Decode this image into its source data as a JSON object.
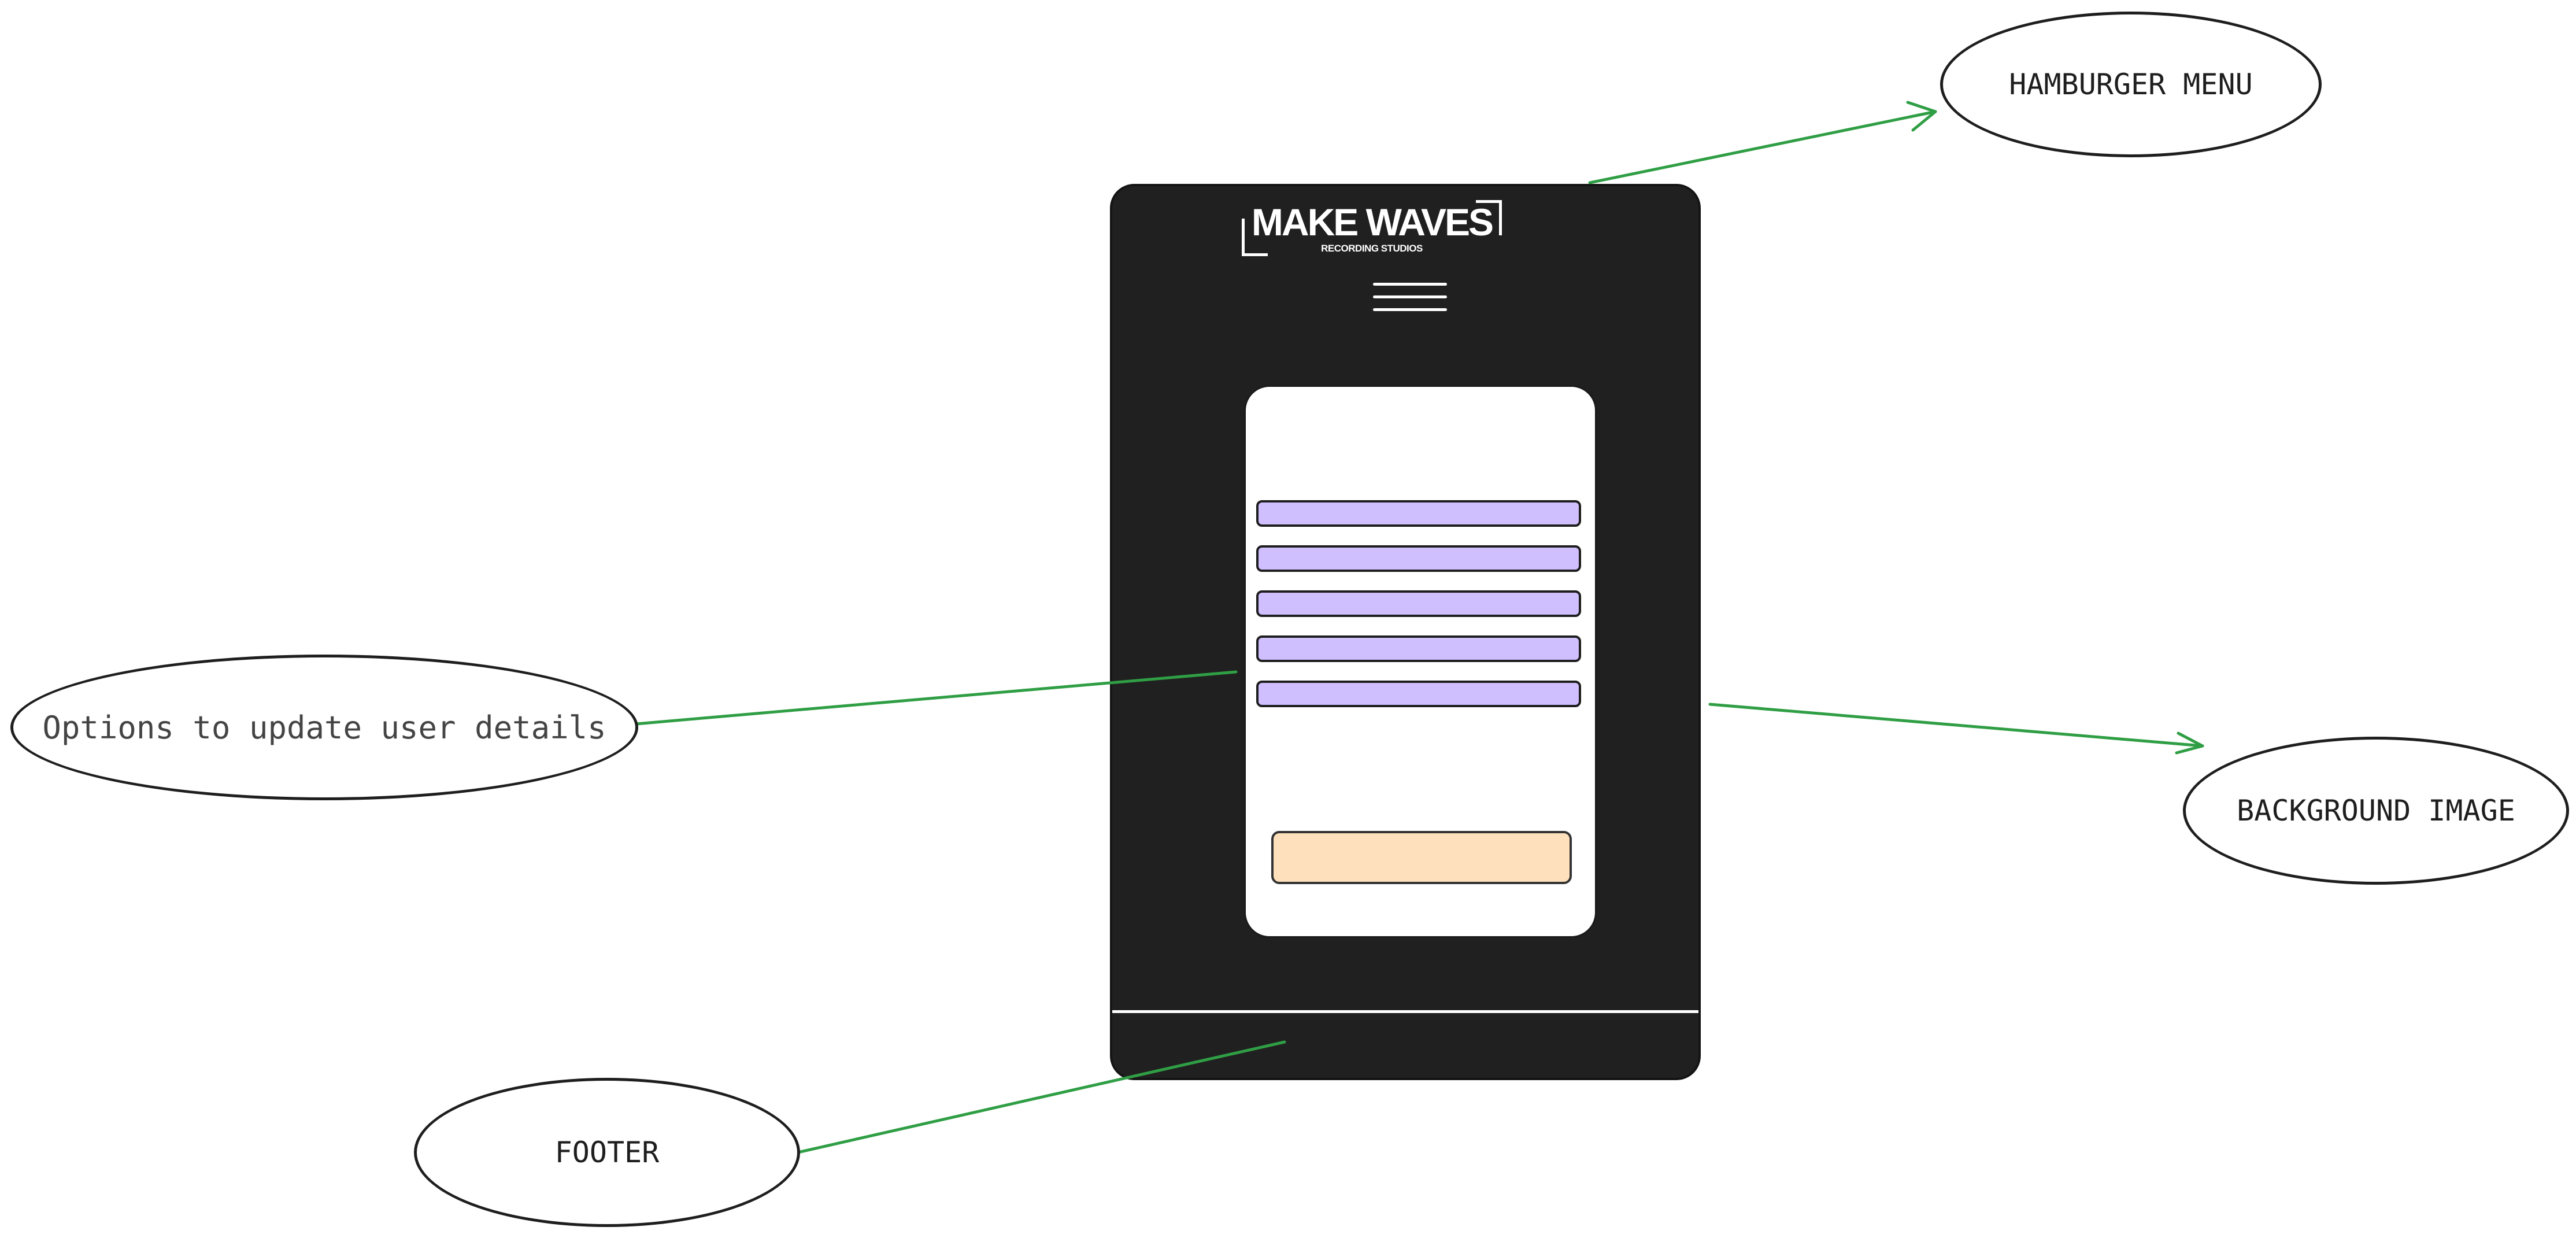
{
  "logo": {
    "title": "MAKE WAVES",
    "subtitle": "RECORDING STUDIOS"
  },
  "annotations": {
    "hamburger_menu": "HAMBURGER MENU",
    "background_image": "BACKGROUND IMAGE",
    "options": "Options to update user details",
    "footer": "FOOTER"
  },
  "form": {
    "field_count": 5
  },
  "colors": {
    "phone_background": "#202020",
    "field_fill": "#d0bfff",
    "button_fill": "#ffe0bc",
    "arrow": "#2f9e44"
  }
}
